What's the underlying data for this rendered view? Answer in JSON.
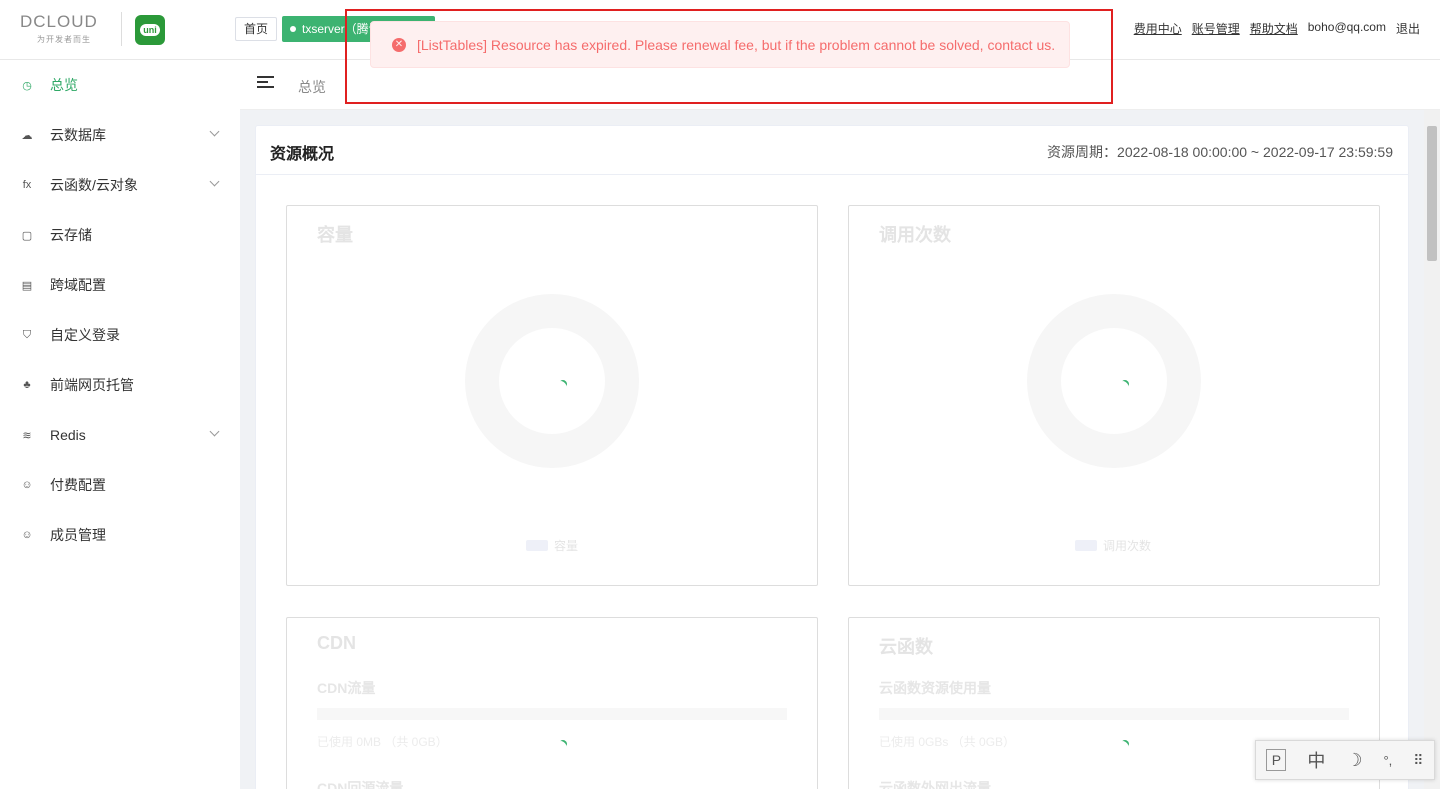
{
  "header": {
    "logo_text": "DCLOUD",
    "logo_slogan": "为开发者而生",
    "uni_logo_text": "uni",
    "home_label": "首页",
    "space_label": "txserver（腾讯云）",
    "links": {
      "billing": "费用中心",
      "account": "账号管理",
      "help": "帮助文档",
      "email": "boho@qq.com",
      "logout": "退出"
    }
  },
  "error": {
    "message": "[ListTables] Resource has expired. Please renewal fee, but if the problem cannot be solved, contact us.",
    "icon": "close-circle-icon",
    "color": "#f56c6c"
  },
  "sidebar": {
    "items": [
      {
        "label": "总览",
        "icon": "dashboard-icon",
        "glyph": "◷",
        "active": true
      },
      {
        "label": "云数据库",
        "icon": "database-icon",
        "glyph": "☁",
        "expandable": true
      },
      {
        "label": "云函数/云对象",
        "icon": "function-icon",
        "glyph": "fx",
        "expandable": true
      },
      {
        "label": "云存储",
        "icon": "storage-icon",
        "glyph": "▢"
      },
      {
        "label": "跨域配置",
        "icon": "cors-icon",
        "glyph": "▤"
      },
      {
        "label": "自定义登录",
        "icon": "shield-icon",
        "glyph": "⛉"
      },
      {
        "label": "前端网页托管",
        "icon": "hosting-icon",
        "glyph": "♣"
      },
      {
        "label": "Redis",
        "icon": "redis-icon",
        "glyph": "≋",
        "expandable": true
      },
      {
        "label": "付费配置",
        "icon": "payment-icon",
        "glyph": "☺"
      },
      {
        "label": "成员管理",
        "icon": "members-icon",
        "glyph": "☺"
      }
    ]
  },
  "breadcrumb": {
    "current": "总览"
  },
  "overview": {
    "title": "资源概况",
    "period": "资源周期：2022-08-18 00:00:00 ~ 2022-09-17 23:59:59",
    "panels": {
      "capacity": {
        "title": "容量",
        "legend": "容量"
      },
      "calls": {
        "title": "调用次数",
        "legend": "调用次数"
      },
      "cdn": {
        "title": "CDN",
        "traffic_label": "CDN流量",
        "traffic_used": "已使用 0MB （共 0GB）",
        "origin_label": "CDN回源流量"
      },
      "functions": {
        "title": "云函数",
        "usage_label": "云函数资源使用量",
        "usage_used": "已使用 0GBs （共 0GB）",
        "outbound_label": "云函数外网出流量"
      }
    }
  },
  "ime": {
    "p": "P",
    "lang": "中",
    "moon": "☽",
    "punct": "°,",
    "grid": "⠿"
  },
  "colors": {
    "accent": "#2fa866",
    "space_tag": "#3cb371",
    "highlight_box": "#e02020"
  }
}
